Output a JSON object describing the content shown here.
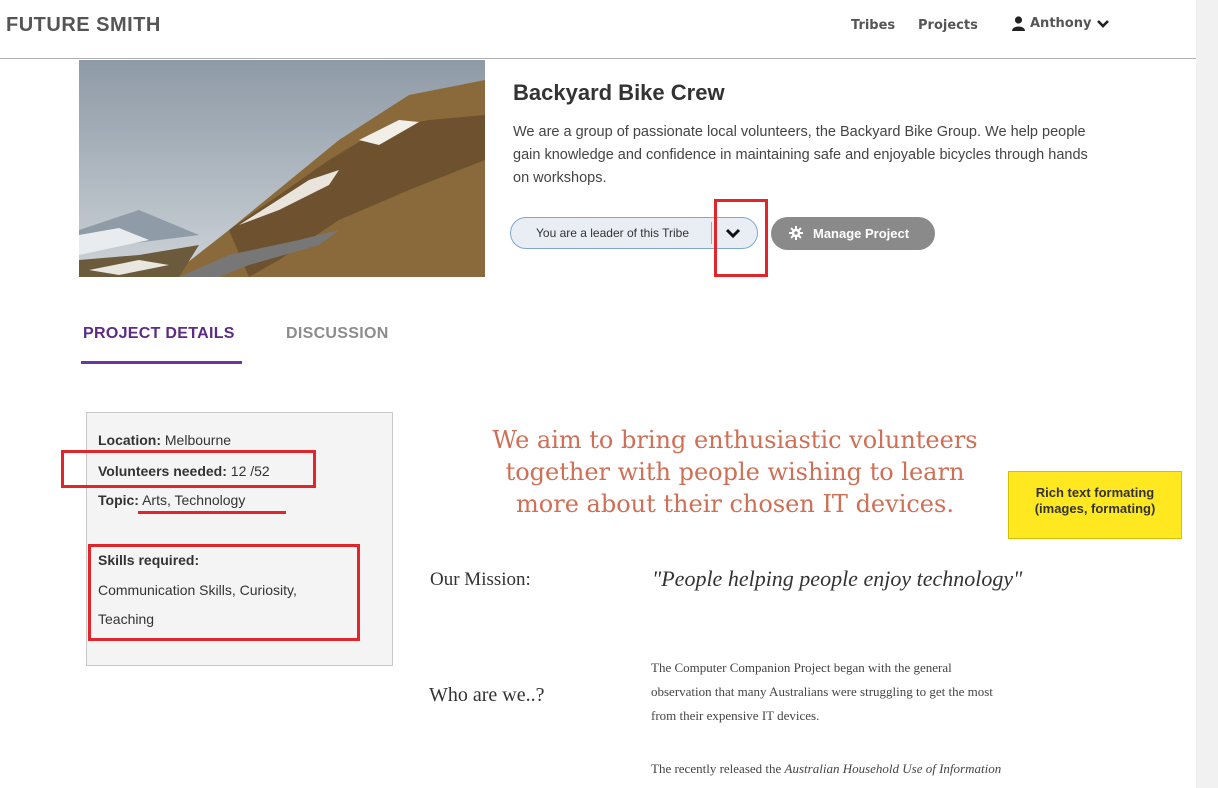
{
  "header": {
    "brand": "FUTURE SMITH",
    "nav": {
      "tribes": "Tribes",
      "projects": "Projects",
      "user": "Anthony"
    }
  },
  "project": {
    "title": "Backyard Bike Crew",
    "description": "We are a group of passionate local volunteers, the Backyard Bike Group. We help people gain knowledge and confidence in maintaining safe and enjoyable bicycles through hands on workshops.",
    "leader_label": "You are a leader of this Tribe",
    "manage_label": "Manage Project"
  },
  "tabs": {
    "details": "PROJECT DETAILS",
    "discussion": "DISCUSSION"
  },
  "info": {
    "location_label": "Location:",
    "location_value": "Melbourne",
    "volunteers_label": "Volunteers needed:",
    "volunteers_value": "12 /52",
    "topic_label": "Topic:",
    "topic_value": "Arts, Technology",
    "skills_label": "Skills required:",
    "skills_line1": "Communication Skills, Curiosity,",
    "skills_line2": "Teaching"
  },
  "content": {
    "headline_1": "We aim to bring enthusiastic volunteers",
    "headline_2": "together with people wishing to learn",
    "headline_3": "more about their chosen IT devices.",
    "mission_label": "Our Mission:",
    "mission_quote": "\"People helping people enjoy technology\"",
    "who_label": "Who are we..?",
    "who_line1": "The Computer Companion Project began with the general",
    "who_line2": "observation that many Australians were struggling to get the most",
    "who_line3": "from their expensive IT devices.",
    "recent_prefix": "The recently released the ",
    "recent_italic": "Australian Household Use of Information"
  },
  "annotation": {
    "note": "Rich text formating (images, formating)"
  },
  "colors": {
    "accent_purple": "#5b2b86",
    "annotation_red": "#e0262a",
    "headline_coral": "#cf6f55",
    "note_yellow": "#ffe820"
  }
}
